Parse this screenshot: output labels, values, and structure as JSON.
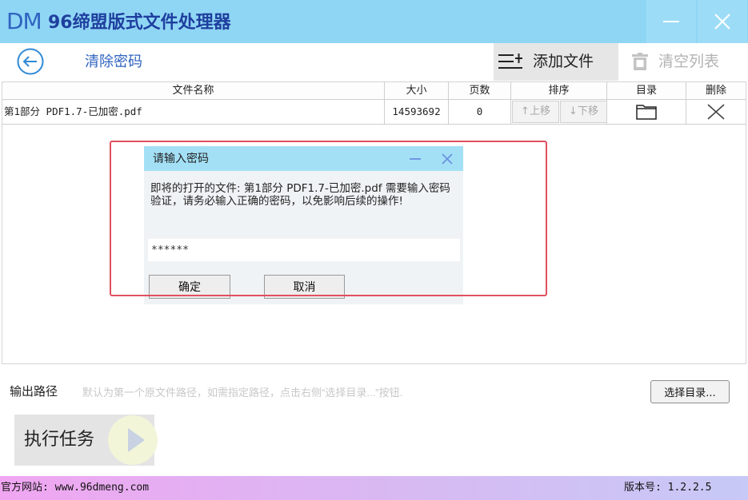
{
  "app": {
    "logo": "DM",
    "title": "96缔盟版式文件处理器"
  },
  "toolbar": {
    "page_title": "清除密码",
    "add_file": "添加文件",
    "clear_list": "清空列表"
  },
  "table": {
    "columns": [
      "文件名称",
      "大小",
      "页数",
      "排序",
      "目录",
      "删除"
    ],
    "rows": [
      {
        "name": "第1部分 PDF1.7-已加密.pdf",
        "size": "14593692",
        "pages": "0",
        "move_up": "↑上移",
        "move_down": "↓下移"
      }
    ]
  },
  "dialog": {
    "title": "请输入密码",
    "message": "即将的打开的文件: 第1部分 PDF1.7-已加密.pdf 需要输入密码验证，请务必输入正确的密码，以免影响后续的操作!",
    "password_value": "******",
    "ok": "确定",
    "cancel": "取消"
  },
  "output": {
    "label": "输出路径",
    "placeholder": "默认为第一个原文件路径，如需指定路径，点击右侧“选择目录...”按钮.",
    "choose_button": "选择目录..."
  },
  "execute": {
    "label": "执行任务"
  },
  "statusbar": {
    "website": "官方网站:  www.96dmeng.com",
    "version": "版本号: 1.2.2.5"
  },
  "colors": {
    "titlebar": "#8fd6f5",
    "accent_blue": "#2f63c0",
    "dialog_header": "#a3e0f6",
    "highlight_red": "#e05060"
  }
}
